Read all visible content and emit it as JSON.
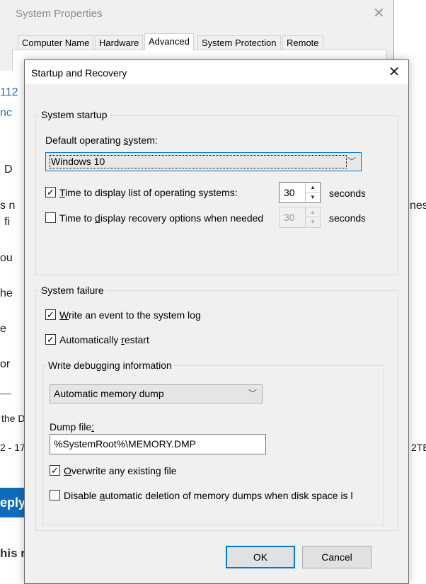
{
  "background_page": {
    "fragments": [
      {
        "text": "112",
        "style": "link"
      },
      {
        "text": "nc",
        "style": "link"
      },
      {
        "text": "D",
        "style": "normal"
      },
      {
        "text": "s n",
        "style": "normal"
      },
      {
        "text": "fi",
        "style": "normal"
      },
      {
        "text": "nes",
        "style": "normal"
      },
      {
        "text": "ou",
        "style": "normal"
      },
      {
        "text": "he",
        "style": "normal"
      },
      {
        "text": "e",
        "style": "normal"
      },
      {
        "text": "or",
        "style": "normal"
      },
      {
        "text": "the D",
        "style": "small"
      },
      {
        "text": "2 - 17",
        "style": "small"
      },
      {
        "text": "2TE",
        "style": "small"
      },
      {
        "text": "his r",
        "style": "bold"
      }
    ],
    "reply_button": "eply"
  },
  "system_properties": {
    "title": "System Properties",
    "close_glyph": "✕",
    "tabs": [
      {
        "label": "Computer Name",
        "active": false
      },
      {
        "label": "Hardware",
        "active": false
      },
      {
        "label": "Advanced",
        "active": true
      },
      {
        "label": "System Protection",
        "active": false
      },
      {
        "label": "Remote",
        "active": false
      }
    ]
  },
  "dialog": {
    "title": "Startup and Recovery",
    "close_glyph": "✕",
    "system_startup": {
      "group_label": "System startup",
      "default_os_label": "Default operating system:",
      "default_os_value": "Windows 10",
      "display_list": {
        "checked": true,
        "label": "Time to display list of operating systems:",
        "value": "30",
        "unit": "seconds"
      },
      "display_recovery": {
        "checked": false,
        "label": "Time to display recovery options when needed",
        "value": "30",
        "unit": "seconds"
      }
    },
    "system_failure": {
      "group_label": "System failure",
      "write_event": {
        "checked": true,
        "label": "Write an event to the system log"
      },
      "auto_restart": {
        "checked": true,
        "label": "Automatically restart"
      },
      "debug_info": {
        "group_label": "Write debugging information",
        "dump_type": "Automatic memory dump",
        "dump_file_label": "Dump file:",
        "dump_file_value": "%SystemRoot%\\MEMORY.DMP",
        "overwrite": {
          "checked": true,
          "label": "Overwrite any existing file"
        },
        "disable_auto_delete": {
          "checked": false,
          "label": "Disable automatic deletion of memory dumps when disk space is l"
        }
      }
    },
    "buttons": {
      "ok": "OK",
      "cancel": "Cancel"
    }
  },
  "icons": {
    "check": "✓",
    "chevron_down": "﹀",
    "spin_up": "▲",
    "spin_down": "▼"
  },
  "colors": {
    "accent": "#0078d7",
    "link": "#2a6fb4",
    "reply_button": "#0f6cbd",
    "dialog_bg": "#f0f0f0"
  }
}
